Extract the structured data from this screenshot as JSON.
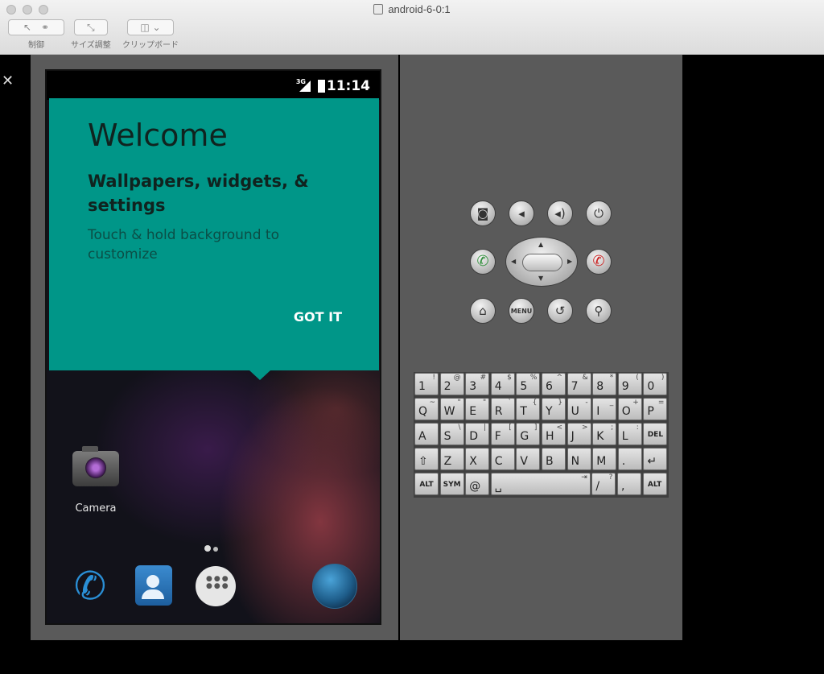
{
  "window": {
    "title": "android-6-0:1",
    "toolbar": {
      "control_label": "制御",
      "resize_label": "サイズ調整",
      "clipboard_label": "クリップボード"
    }
  },
  "status_bar": {
    "network": "3G",
    "time": "11:14"
  },
  "welcome": {
    "title": "Welcome",
    "subtitle": "Wallpapers, widgets, & settings",
    "description": "Touch & hold background to customize",
    "action": "GOT IT",
    "card_color": "#009688"
  },
  "home": {
    "camera_label": "Camera",
    "dock": [
      "phone-icon",
      "contacts-icon",
      "apps-icon",
      "browser-icon"
    ]
  },
  "hardware_buttons": {
    "row1": [
      "camera-icon",
      "volume-down-icon",
      "volume-up-icon",
      "power-icon"
    ],
    "row2": [
      "call-icon",
      "dpad",
      "hangup-icon"
    ],
    "row3": [
      "home-icon",
      "MENU",
      "back-icon",
      "search-icon"
    ]
  },
  "keyboard": {
    "row1": [
      [
        "1",
        "!"
      ],
      [
        "2",
        "@"
      ],
      [
        "3",
        "#"
      ],
      [
        "4",
        "$"
      ],
      [
        "5",
        "%"
      ],
      [
        "6",
        "^"
      ],
      [
        "7",
        "&"
      ],
      [
        "8",
        "*"
      ],
      [
        "9",
        "("
      ],
      [
        "0",
        ")"
      ]
    ],
    "row2": [
      [
        "Q",
        "~"
      ],
      [
        "W",
        "\""
      ],
      [
        "E",
        "\""
      ],
      [
        "R",
        "`"
      ],
      [
        "T",
        "{"
      ],
      [
        "Y",
        "}"
      ],
      [
        "U",
        "-"
      ],
      [
        "I",
        "_"
      ],
      [
        "O",
        "+"
      ],
      [
        "P",
        "="
      ]
    ],
    "row3": [
      [
        "A",
        ""
      ],
      [
        "S",
        "\\"
      ],
      [
        "D",
        "|"
      ],
      [
        "F",
        "["
      ],
      [
        "G",
        "]"
      ],
      [
        "H",
        "<"
      ],
      [
        "J",
        ">"
      ],
      [
        "K",
        ";"
      ],
      [
        "L",
        ":"
      ],
      [
        "DEL",
        ""
      ]
    ],
    "row4": [
      [
        "⇧",
        ""
      ],
      [
        "Z",
        ""
      ],
      [
        "X",
        ""
      ],
      [
        "C",
        ""
      ],
      [
        "V",
        ""
      ],
      [
        "B",
        ""
      ],
      [
        "N",
        ""
      ],
      [
        "M",
        ""
      ],
      [
        ".",
        ""
      ],
      [
        "↵",
        ""
      ]
    ],
    "row5": [
      [
        "ALT",
        ""
      ],
      [
        "SYM",
        ""
      ],
      [
        "@",
        ""
      ],
      [
        "␣",
        "⇥"
      ],
      [
        "/",
        "?"
      ],
      [
        ",",
        ""
      ],
      [
        "ALT",
        ""
      ]
    ]
  }
}
